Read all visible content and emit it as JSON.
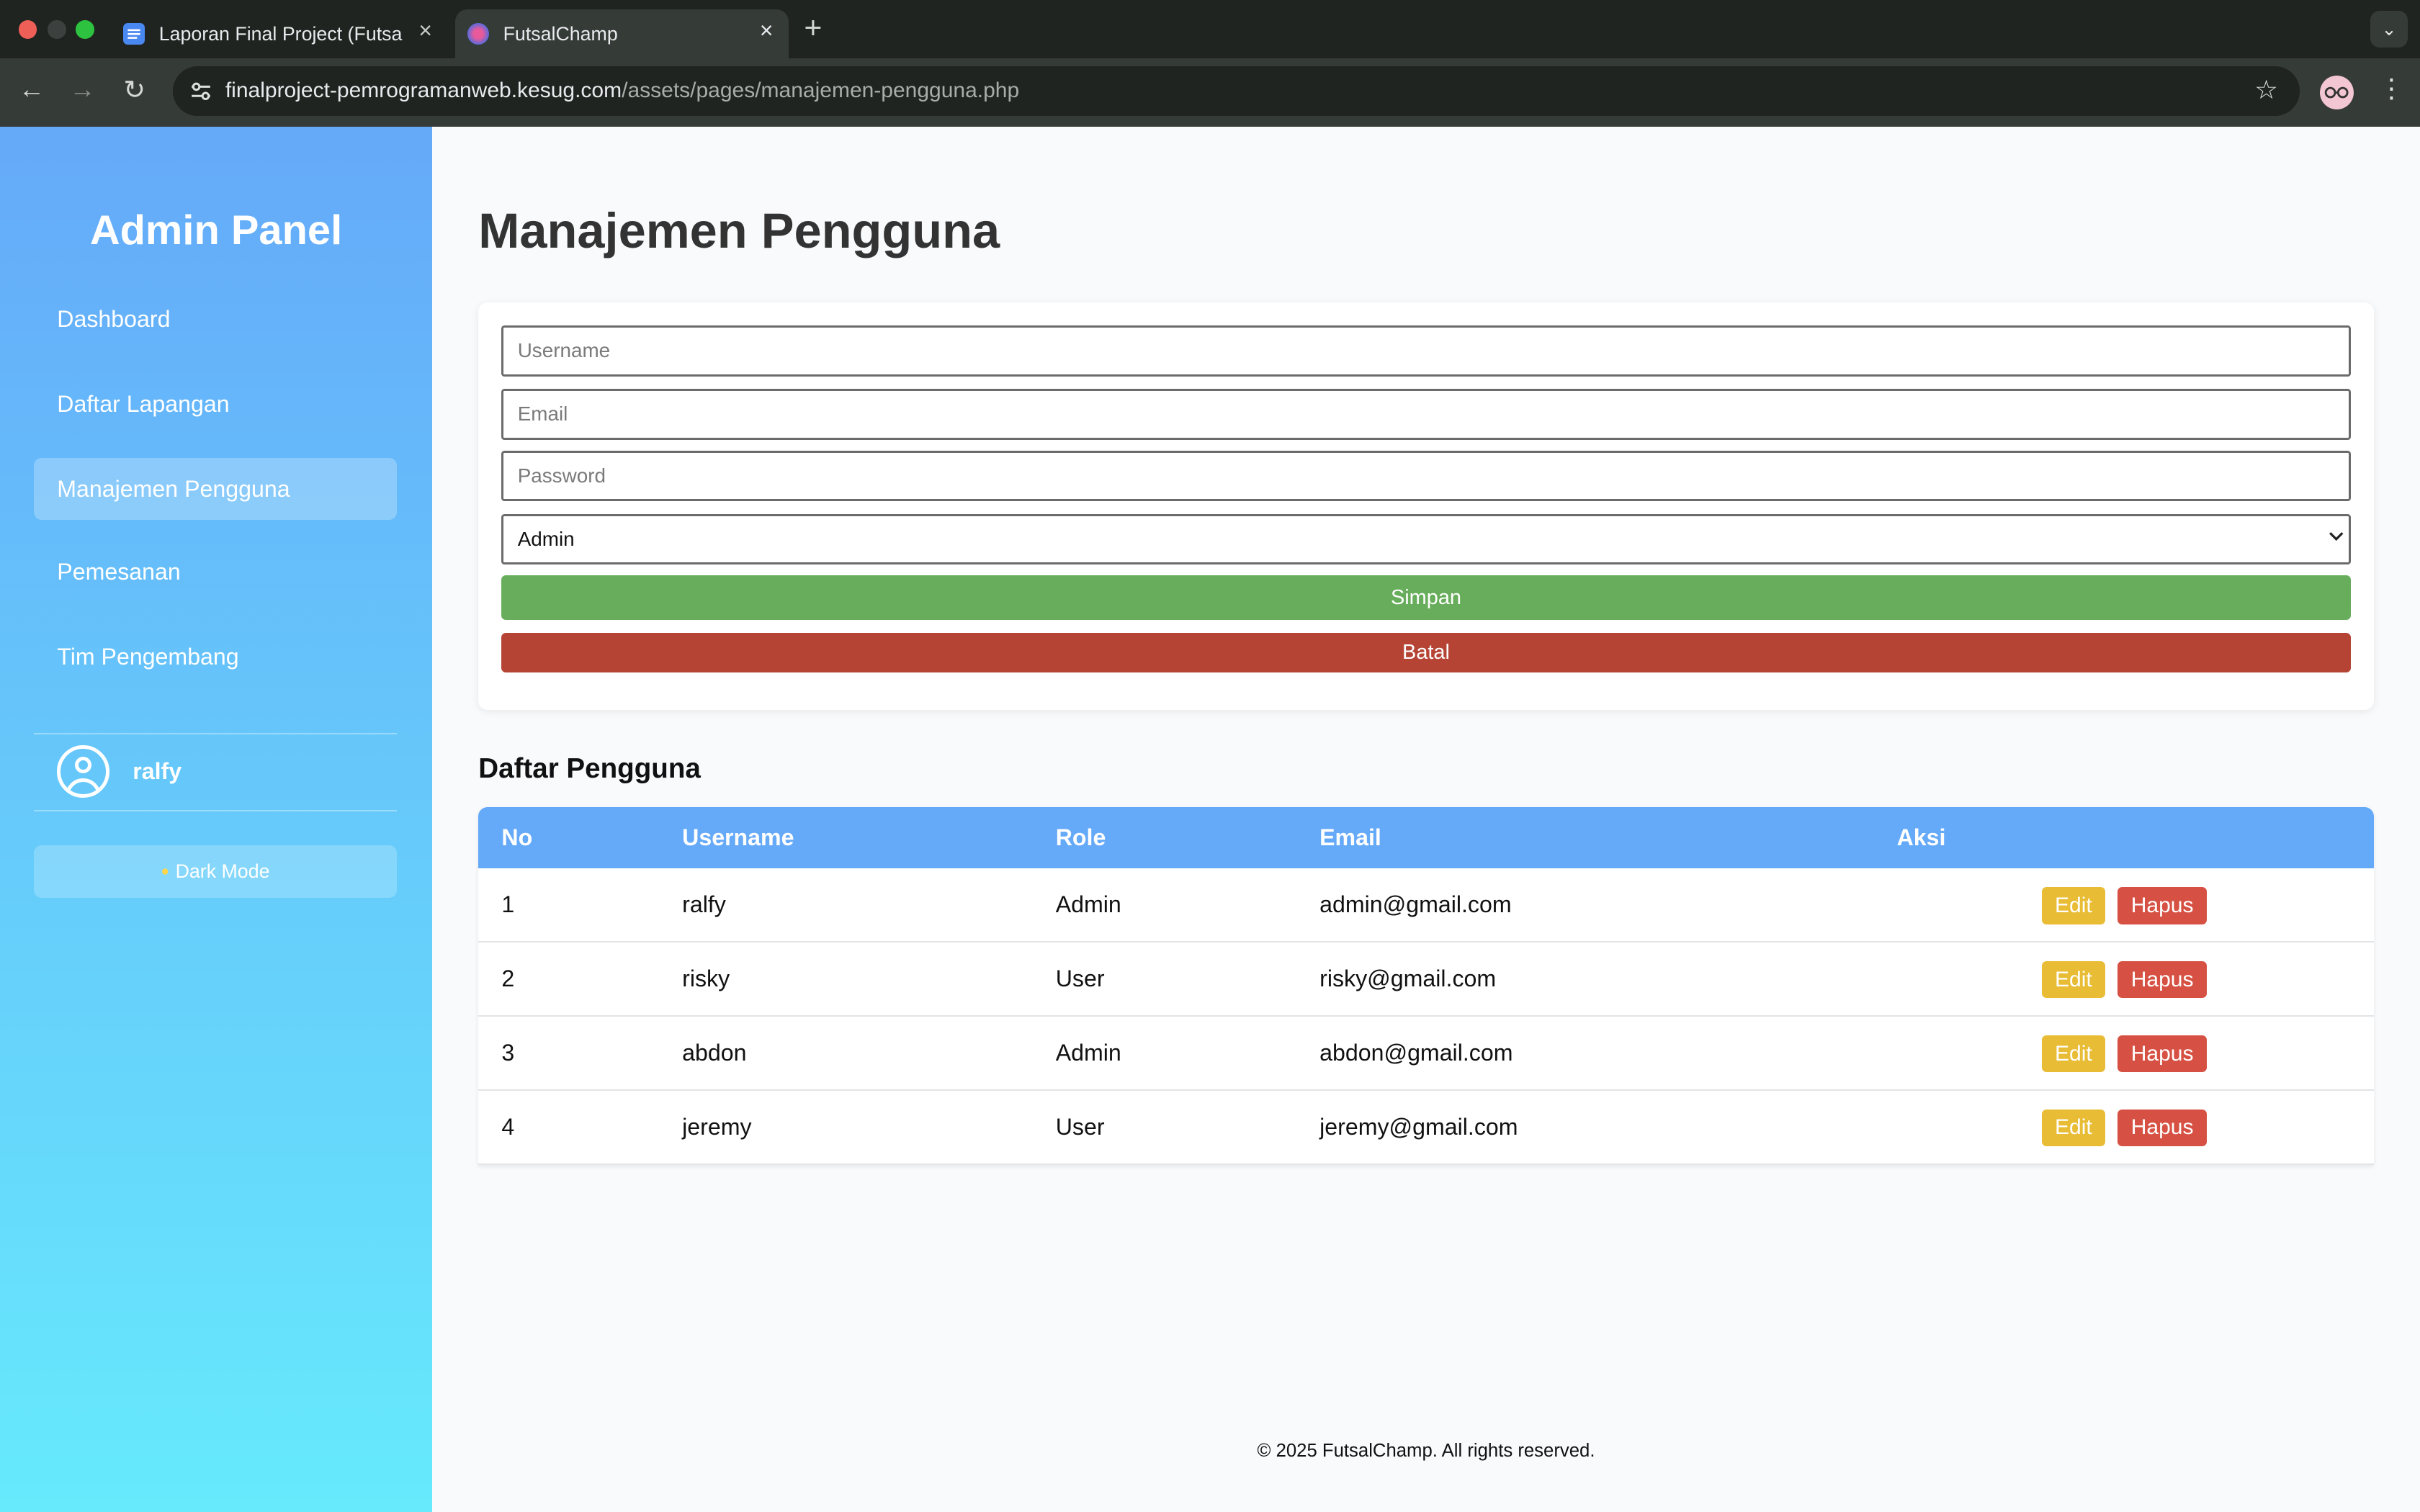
{
  "browser": {
    "tabs": [
      {
        "title": "Laporan Final Project (FutsalC",
        "active": false
      },
      {
        "title": "FutsalChamp",
        "active": true
      }
    ],
    "url_host": "finalproject-pemrogramanweb.kesug.com",
    "url_path": "/assets/pages/manajemen-pengguna.php",
    "icons": {
      "close": "×",
      "new_tab": "+",
      "tab_menu": "⌄",
      "back": "←",
      "forward": "→",
      "reload": "↻",
      "star": "☆",
      "menu": "⋮"
    },
    "colors": {
      "bg": "#1f2420",
      "bar": "#353b37"
    }
  },
  "sidebar": {
    "title": "Admin Panel",
    "items": [
      {
        "label": "Dashboard",
        "active": false
      },
      {
        "label": "Daftar Lapangan",
        "active": false
      },
      {
        "label": "Manajemen Pengguna",
        "active": true
      },
      {
        "label": "Pemesanan",
        "active": false
      },
      {
        "label": "Tim Pengembang",
        "active": false
      }
    ],
    "user": {
      "name": "ralfy"
    },
    "dark_mode_label": "Dark Mode",
    "gradient": [
      "#65a9f9",
      "#66eafc"
    ]
  },
  "main": {
    "title": "Manajemen Pengguna",
    "form": {
      "username_placeholder": "Username",
      "email_placeholder": "Email",
      "password_placeholder": "Password",
      "role_selected": "Admin",
      "save_label": "Simpan",
      "cancel_label": "Batal"
    },
    "list_title": "Daftar Pengguna",
    "table": {
      "headers": [
        "No",
        "Username",
        "Role",
        "Email",
        "Aksi"
      ],
      "rows": [
        {
          "no": "1",
          "username": "ralfy",
          "role": "Admin",
          "email": "admin@gmail.com"
        },
        {
          "no": "2",
          "username": "risky",
          "role": "User",
          "email": "risky@gmail.com"
        },
        {
          "no": "3",
          "username": "abdon",
          "role": "Admin",
          "email": "abdon@gmail.com"
        },
        {
          "no": "4",
          "username": "jeremy",
          "role": "User",
          "email": "jeremy@gmail.com"
        }
      ],
      "edit_label": "Edit",
      "delete_label": "Hapus"
    },
    "colors": {
      "header": "#65a9f9",
      "save": "#68ad5b",
      "cancel": "#b54435",
      "edit": "#e8bc35",
      "delete": "#d65143"
    }
  },
  "footer": "© 2025 FutsalChamp. All rights reserved."
}
